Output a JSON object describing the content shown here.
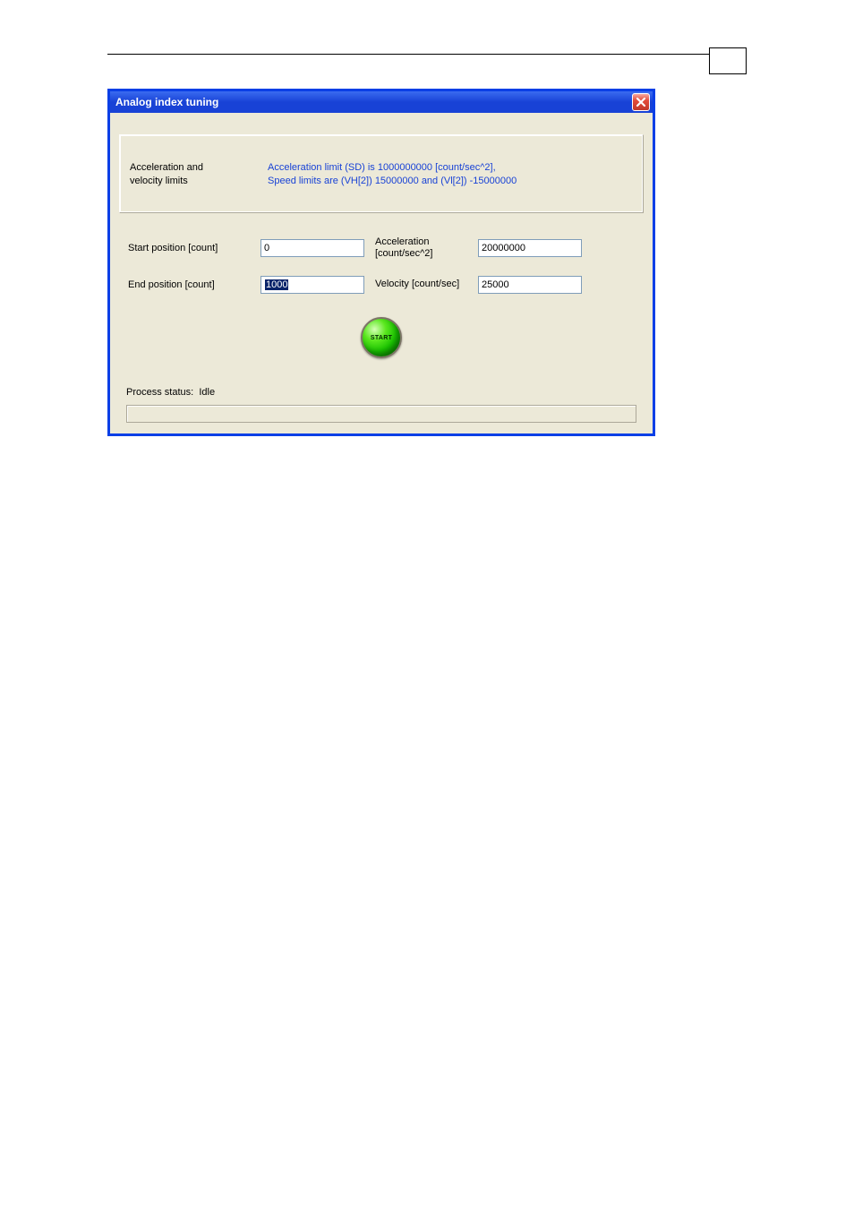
{
  "dialog": {
    "title": "Analog index tuning",
    "info": {
      "label": "Acceleration and velocity limits",
      "line1": "Acceleration limit (SD) is 1000000000 [count/sec^2],",
      "line2": "Speed limits are (VH[2]) 15000000 and (Vl[2]) -15000000"
    },
    "fields": {
      "start_pos_label": "Start position [count]",
      "start_pos_value": "0",
      "end_pos_label": "End position [count]",
      "end_pos_value": "1000",
      "accel_label": "Acceleration [count/sec^2]",
      "accel_value": "20000000",
      "velocity_label": "Velocity [count/sec]",
      "velocity_value": "25000"
    },
    "start_button": "START",
    "status_label": "Process status:",
    "status_value": "Idle"
  }
}
